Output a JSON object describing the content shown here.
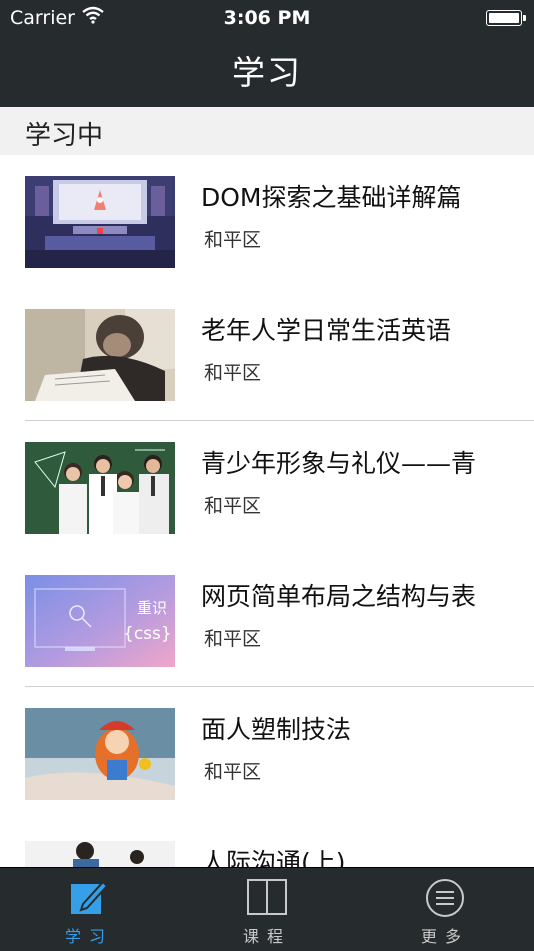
{
  "status_bar": {
    "carrier": "Carrier",
    "time": "3:06 PM"
  },
  "nav": {
    "title": "学习"
  },
  "section": {
    "title": "学习中"
  },
  "courses": [
    {
      "title": "DOM探索之基础详解篇",
      "location": "和平区",
      "thumb": "classroom-illustration"
    },
    {
      "title": "老年人学日常生活英语",
      "location": "和平区",
      "thumb": "elderly-reading-photo"
    },
    {
      "title": "青少年形象与礼仪——青",
      "location": "和平区",
      "thumb": "students-photo"
    },
    {
      "title": "网页简单布局之结构与表",
      "location": "和平区",
      "thumb": "css-banner"
    },
    {
      "title": "面人塑制技法",
      "location": "和平区",
      "thumb": "dough-figure-photo"
    },
    {
      "title": "人际沟通(上)",
      "location": "",
      "thumb": "people-photo"
    }
  ],
  "thumb_text": {
    "css_title": "重识",
    "css_sub": "{css}"
  },
  "tabs": [
    {
      "label": "学习",
      "icon": "pencil-square-icon",
      "active": true
    },
    {
      "label": "课程",
      "icon": "book-icon",
      "active": false
    },
    {
      "label": "更多",
      "icon": "menu-circle-icon",
      "active": false
    }
  ],
  "colors": {
    "bar_background": "#262b2d",
    "active_tab": "#35a0e8",
    "inactive_tab": "#c9c9c9"
  }
}
